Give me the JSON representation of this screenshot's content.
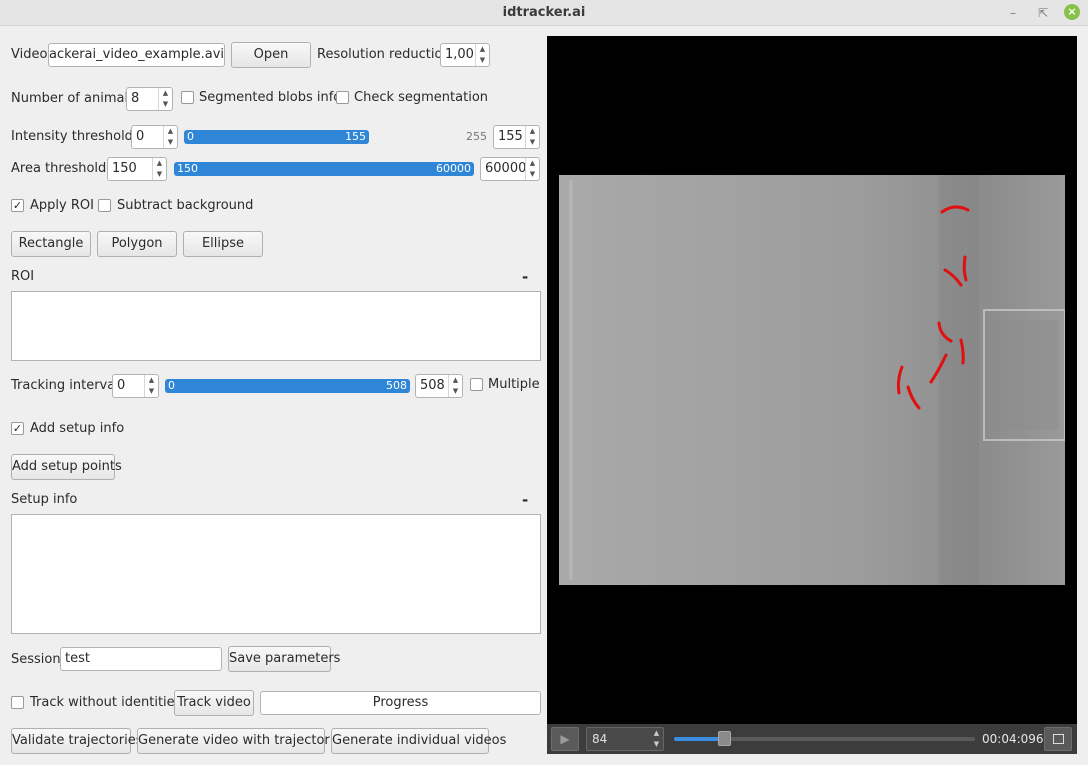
{
  "window": {
    "title": "idtracker.ai",
    "minimize_icon": "minimize-icon",
    "maximize_icon": "maximize-icon",
    "close_icon": "close-icon"
  },
  "video": {
    "label": "Video",
    "file_value": "/idtrackerai_video_example.avi",
    "open_label": "Open",
    "resolution_label": "Resolution reduction",
    "resolution_value": "1,00"
  },
  "animals": {
    "label": "Number of animals",
    "value": "8",
    "segmented_blobs_label": "Segmented blobs info",
    "check_segmentation_label": "Check segmentation"
  },
  "intensity": {
    "label": "Intensity thresholds",
    "min_value": "0",
    "slider_low": "0",
    "slider_high": "155",
    "max_scale": "255",
    "max_value": "155"
  },
  "area": {
    "label": "Area thresholds",
    "min_value": "150",
    "slider_low": "150",
    "slider_high": "60000",
    "max_value": "60000"
  },
  "roi": {
    "apply_roi_label": "Apply ROI",
    "apply_roi_checked": true,
    "subtract_background_label": "Subtract background",
    "rectangle_label": "Rectangle",
    "polygon_label": "Polygon",
    "ellipse_label": "Ellipse",
    "section_label": "ROI",
    "minus_label": "-"
  },
  "tracking": {
    "label": "Tracking interval",
    "start_value": "0",
    "slider_low": "0",
    "slider_high": "508",
    "end_value": "508",
    "multiple_label": "Multiple"
  },
  "setup": {
    "add_setup_info_label": "Add setup info",
    "add_setup_info_checked": true,
    "add_setup_points_label": "Add setup points",
    "section_label": "Setup info",
    "minus_label": "-"
  },
  "session": {
    "label": "Session",
    "value": "test",
    "save_label": "Save parameters"
  },
  "actions": {
    "track_without_identities_label": "Track without identities",
    "track_video_label": "Track video",
    "progress_label": "Progress",
    "validate_label": "Validate trajectories",
    "generate_video_label": "Generate video with trajectories",
    "generate_individual_label": "Generate individual videos"
  },
  "player": {
    "frame_value": "84",
    "time": "00:04:096",
    "position_fraction": 0.165,
    "play_icon": "play-icon",
    "fullscreen_icon": "fullscreen-icon"
  },
  "colors": {
    "accent": "#2f86d6",
    "fish": "#e01010"
  }
}
